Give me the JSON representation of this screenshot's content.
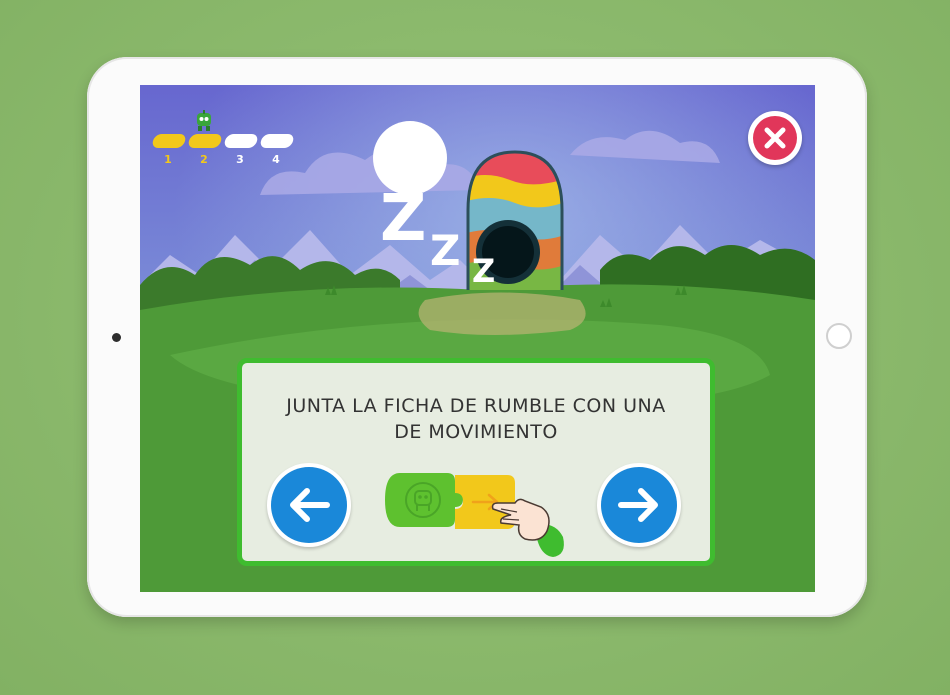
{
  "app": {
    "progress": {
      "current_step": 2,
      "steps": [
        {
          "label": "1",
          "done": true
        },
        {
          "label": "2",
          "done": true
        },
        {
          "label": "3",
          "done": false
        },
        {
          "label": "4",
          "done": false
        }
      ]
    },
    "scene": {
      "sleep_text": {
        "big": "Z",
        "mid": "Z",
        "small": "Z"
      }
    },
    "instruction_card": {
      "line1": "JUNTA LA FICHA DE RUMBLE CON UNA",
      "line2": "DE MOVIMIENTO"
    }
  },
  "icons": {
    "close": "close-x-icon",
    "back": "arrow-left-icon",
    "next": "arrow-right-icon",
    "robot": "robot-icon",
    "tap_hand": "tapping-hand-icon"
  },
  "colors": {
    "progress_done": "#f2c81b",
    "progress_todo": "#ffffff",
    "close_red": "#e1365a",
    "nav_blue": "#1a88d9",
    "panel_border": "#3fbc2f",
    "panel_bg": "#e7ede1",
    "tile_green": "#5ec12f",
    "tile_yellow": "#f2c81b"
  }
}
